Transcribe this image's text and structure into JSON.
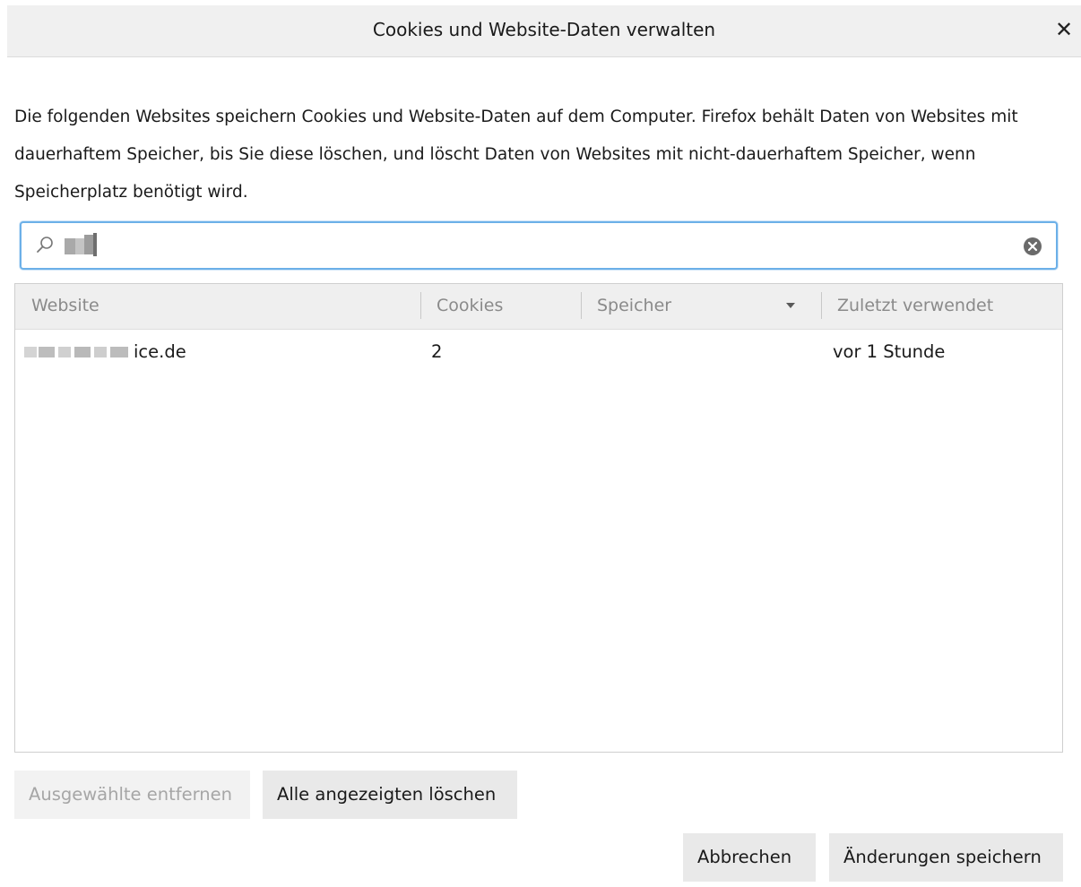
{
  "dialog": {
    "title": "Cookies und Website-Daten verwalten",
    "close_glyph": "✕"
  },
  "description": "Die folgenden Websites speichern Cookies und Website-Daten auf dem Computer. Firefox behält Daten von Websites mit dauerhaftem Speicher, bis Sie diese löschen, und löscht Daten von Websites mit nicht-dauerhaftem Speicher, wenn Speicherplatz benötigt wird.",
  "search": {
    "icon": "search-icon",
    "clear_icon": "clear-circle-icon"
  },
  "table": {
    "headers": {
      "website": "Website",
      "cookies": "Cookies",
      "storage": "Speicher",
      "last_used": "Zuletzt verwendet"
    },
    "rows": [
      {
        "website_suffix": "ice.de",
        "cookies": "2",
        "storage": "",
        "last_used": "vor 1 Stunde"
      }
    ]
  },
  "buttons": {
    "remove_selected": "Ausgewählte entfernen",
    "remove_all_shown": "Alle angezeigten löschen",
    "cancel": "Abbrechen",
    "save": "Änderungen speichern"
  },
  "colors": {
    "focus_border": "#6cb0e8",
    "header_bg": "#efefef",
    "button_bg": "#e9e9e9"
  }
}
